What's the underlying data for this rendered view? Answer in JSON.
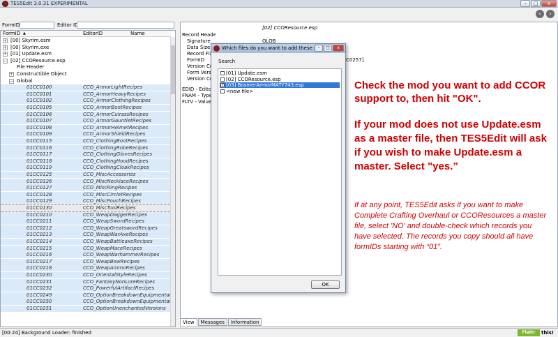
{
  "window": {
    "title": "TES5Edit 3.0.31 EXPERIMENTAL",
    "min": "–",
    "max": "□",
    "close": "x"
  },
  "toolbar": {
    "back": "‹",
    "forward": "›"
  },
  "filters": {
    "formid_label": "FormID",
    "editorid_label": "Editor ID"
  },
  "columns": {
    "formid": "FormID",
    "sort_arrow": "▲",
    "editorid": "EditorID",
    "name": "Name"
  },
  "tree": [
    {
      "expander": "+",
      "text": "[00] Skyrim.esm",
      "indent": 0
    },
    {
      "expander": "+",
      "text": "[00] Skyrim.exe",
      "indent": 0
    },
    {
      "expander": "+",
      "text": "[01] Update.esm",
      "indent": 0
    },
    {
      "expander": "−",
      "text": "[02] CCOResource.esp",
      "indent": 0
    },
    {
      "expander": "",
      "text": "File Header",
      "indent": 1
    },
    {
      "expander": "+",
      "text": "Constructible Object",
      "indent": 1
    },
    {
      "expander": "−",
      "text": "Global",
      "indent": 1
    }
  ],
  "records": [
    {
      "id": "01CC0100",
      "editor": "CCO_ArmorLightRecipes"
    },
    {
      "id": "01CC0101",
      "editor": "CCO_ArmorHeavyRecipes"
    },
    {
      "id": "01CC0102",
      "editor": "CCO_ArmorClothingRecipes"
    },
    {
      "id": "01CC0105",
      "editor": "CCO_ArmorBootRecipes"
    },
    {
      "id": "01CC0106",
      "editor": "CCO_ArmorCuirassRecipes"
    },
    {
      "id": "01CC0107",
      "editor": "CCO_ArmorGauntletRecipes"
    },
    {
      "id": "01CC0108",
      "editor": "CCO_ArmorHelmetRecipes"
    },
    {
      "id": "01CC0109",
      "editor": "CCO_ArmorShieldRecipes"
    },
    {
      "id": "01CC0115",
      "editor": "CCO_ClothingBootRecipes"
    },
    {
      "id": "01CC0116",
      "editor": "CCO_ClothingRobeRecipes"
    },
    {
      "id": "01CC0117",
      "editor": "CCO_ClothingGlovesRecipes"
    },
    {
      "id": "01CC0118",
      "editor": "CCO_ClothingHoodRecipes"
    },
    {
      "id": "01CC0119",
      "editor": "CCO_ClothingCloakRecipes"
    },
    {
      "id": "01CC0125",
      "editor": "CCO_MiscAccessories"
    },
    {
      "id": "01CC0126",
      "editor": "CCO_MiscNecklaceRecipes"
    },
    {
      "id": "01CC0127",
      "editor": "CCO_MiscRingRecipes"
    },
    {
      "id": "01CC0128",
      "editor": "CCO_MiscCircletRecipes"
    },
    {
      "id": "01CC0129",
      "editor": "CCO_MiscPouchRecipes"
    },
    {
      "id": "01CC0130",
      "editor": "CCO_MiscToolRecipes"
    },
    {
      "id": "01CC0210",
      "editor": "CCO_WeapDaggerRecipes"
    },
    {
      "id": "01CC0211",
      "editor": "CCO_WeapSwordRecipes"
    },
    {
      "id": "01CC0212",
      "editor": "CCO_WeapGreatswordRecipes"
    },
    {
      "id": "01CC0213",
      "editor": "CCO_WeapWarAxeRecipes"
    },
    {
      "id": "01CC0214",
      "editor": "CCO_WeapBattleaxeRecipes"
    },
    {
      "id": "01CC0215",
      "editor": "CCO_WeapMaceRecipes"
    },
    {
      "id": "01CC0216",
      "editor": "CCO_WeapWarhammerRecipes"
    },
    {
      "id": "01CC0217",
      "editor": "CCO_WeapBowRecipes"
    },
    {
      "id": "01CC0218",
      "editor": "CCO_WeapAmmoRecipes"
    },
    {
      "id": "01CC0230",
      "editor": "CCO_OrientalStyleRecipes"
    },
    {
      "id": "01CC0231",
      "editor": "CCO_FantasyNonLoreRecipes"
    },
    {
      "id": "01CC0232",
      "editor": "CCO_PowerfulArtifactRecipes"
    },
    {
      "id": "01CC0249",
      "editor": "CCO_OptionBreakdownEquipmentatTa..."
    },
    {
      "id": "01CC0250",
      "editor": "CCO_OptionBreakdownEquipmentatSm..."
    },
    {
      "id": "01CC0251",
      "editor": "CCO_OptionUnenchantedVersions"
    }
  ],
  "right_panel": {
    "header": "[02] CCOResource.esp",
    "rows": [
      {
        "label": "Record Header",
        "value": ""
      },
      {
        "label": "Signature",
        "value": "GLOB"
      },
      {
        "label": "Data Size",
        "value": ""
      },
      {
        "label": "Record Fla",
        "value": ""
      },
      {
        "label": "FormID",
        "value": "C0257]"
      },
      {
        "label": "Version Co",
        "value": ""
      },
      {
        "label": "Form Vers",
        "value": ""
      },
      {
        "label": "Version Co",
        "value": ""
      },
      {
        "label": "EDID - Editor",
        "value": ""
      },
      {
        "label": "FNAM - Type",
        "value": ""
      },
      {
        "label": "FLTV - Value",
        "value": ""
      }
    ],
    "tabs": [
      "View",
      "Messages",
      "Information"
    ]
  },
  "dialog": {
    "title": "Which files do you want to add these re...",
    "search_label": "Search",
    "items": [
      {
        "label": "[01] Update.esm",
        "checked": false,
        "selected": false
      },
      {
        "label": "[02] CCOResource.esp",
        "checked": false,
        "selected": false
      },
      {
        "label": "[03] BosmerArmorMATY743.esp",
        "checked": true,
        "selected": true
      },
      {
        "label": "<new file>",
        "checked": false,
        "selected": false
      }
    ],
    "ok_label": "OK",
    "check_mark": "✓"
  },
  "annotations": {
    "a1": "Check the mod you want to add CCOR support to, then hit \"OK\".",
    "a2": "If your mod does not use Update.esm as a master file, then TES5Edit will ask if you wish to make Update.esm a master.  Select \"yes.”",
    "a3": "If at any point, TES5Edit asks if you want to make Complete Crafting Overhaul or CCOResources a master file, select 'NO' and double-check which records you have selected.  The records you copy should all have formIDs starting with “01”."
  },
  "status": {
    "text": "[00:24] Background Loader: finished",
    "flattr_label": "Flattr",
    "flattr_count": "this!"
  },
  "colors": {
    "annotation": "#d00000",
    "selection": "#dbeaf8",
    "dialog_selection": "#3378d6"
  }
}
